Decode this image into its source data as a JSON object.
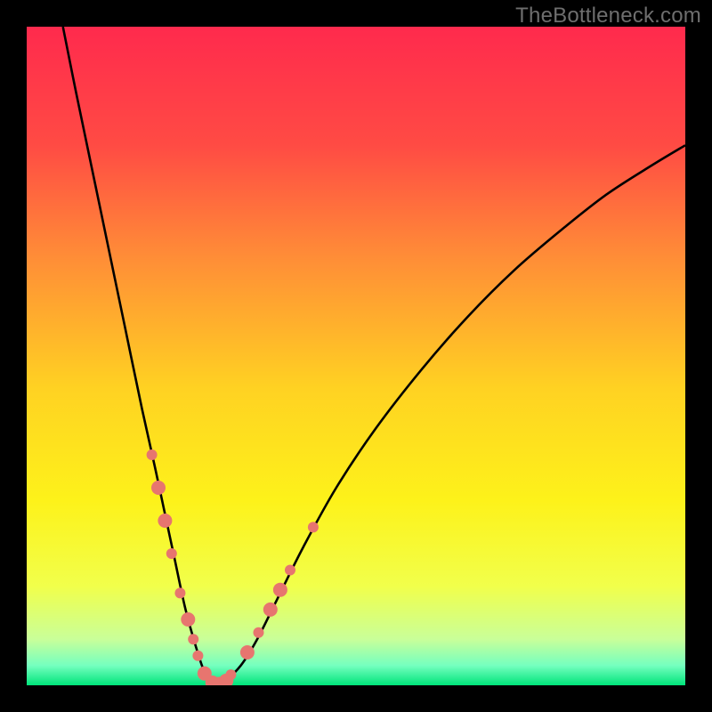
{
  "watermark": "TheBottleneck.com",
  "chart_data": {
    "type": "line",
    "title": "",
    "xlabel": "",
    "ylabel": "",
    "xlim": [
      0,
      100
    ],
    "ylim": [
      0,
      100
    ],
    "background_gradient_stops": [
      {
        "offset": 0.0,
        "color": "#ff2a4d"
      },
      {
        "offset": 0.18,
        "color": "#ff4b44"
      },
      {
        "offset": 0.35,
        "color": "#ff8d37"
      },
      {
        "offset": 0.55,
        "color": "#ffd222"
      },
      {
        "offset": 0.72,
        "color": "#fdf21a"
      },
      {
        "offset": 0.85,
        "color": "#f1ff4b"
      },
      {
        "offset": 0.93,
        "color": "#c9ff99"
      },
      {
        "offset": 0.97,
        "color": "#75ffbf"
      },
      {
        "offset": 1.0,
        "color": "#00e47a"
      }
    ],
    "series": [
      {
        "name": "bottleneck-curve",
        "x": [
          5.5,
          7.5,
          10,
          12.5,
          15,
          17.5,
          19.5,
          21,
          22.5,
          24,
          25.5,
          26.8,
          28,
          29,
          30,
          32.5,
          35,
          38,
          42,
          47,
          53,
          60,
          67,
          74,
          81,
          88,
          95,
          100
        ],
        "y": [
          100,
          90,
          78,
          66,
          54,
          42,
          33,
          26,
          19,
          12,
          6.5,
          2.5,
          0.5,
          0,
          0.5,
          3,
          7,
          13,
          21,
          30,
          39,
          48,
          56,
          63,
          69,
          74.5,
          79,
          82
        ]
      }
    ],
    "markers": {
      "name": "highlight-dots",
      "color": "#e7756f",
      "points": [
        {
          "x": 19.0,
          "y": 35,
          "r": 6
        },
        {
          "x": 20.0,
          "y": 30,
          "r": 8
        },
        {
          "x": 21.0,
          "y": 25,
          "r": 8
        },
        {
          "x": 22.0,
          "y": 20,
          "r": 6
        },
        {
          "x": 23.3,
          "y": 14,
          "r": 6
        },
        {
          "x": 24.5,
          "y": 10,
          "r": 8
        },
        {
          "x": 25.3,
          "y": 7,
          "r": 6
        },
        {
          "x": 26.0,
          "y": 4.5,
          "r": 6
        },
        {
          "x": 27.0,
          "y": 1.8,
          "r": 8
        },
        {
          "x": 28.2,
          "y": 0.4,
          "r": 8
        },
        {
          "x": 29.2,
          "y": 0.2,
          "r": 8
        },
        {
          "x": 30.3,
          "y": 0.7,
          "r": 8
        },
        {
          "x": 31.0,
          "y": 1.6,
          "r": 6
        },
        {
          "x": 33.5,
          "y": 5,
          "r": 8
        },
        {
          "x": 35.2,
          "y": 8,
          "r": 6
        },
        {
          "x": 37.0,
          "y": 11.5,
          "r": 8
        },
        {
          "x": 38.5,
          "y": 14.5,
          "r": 8
        },
        {
          "x": 40.0,
          "y": 17.5,
          "r": 6
        },
        {
          "x": 43.5,
          "y": 24,
          "r": 6
        }
      ]
    }
  }
}
